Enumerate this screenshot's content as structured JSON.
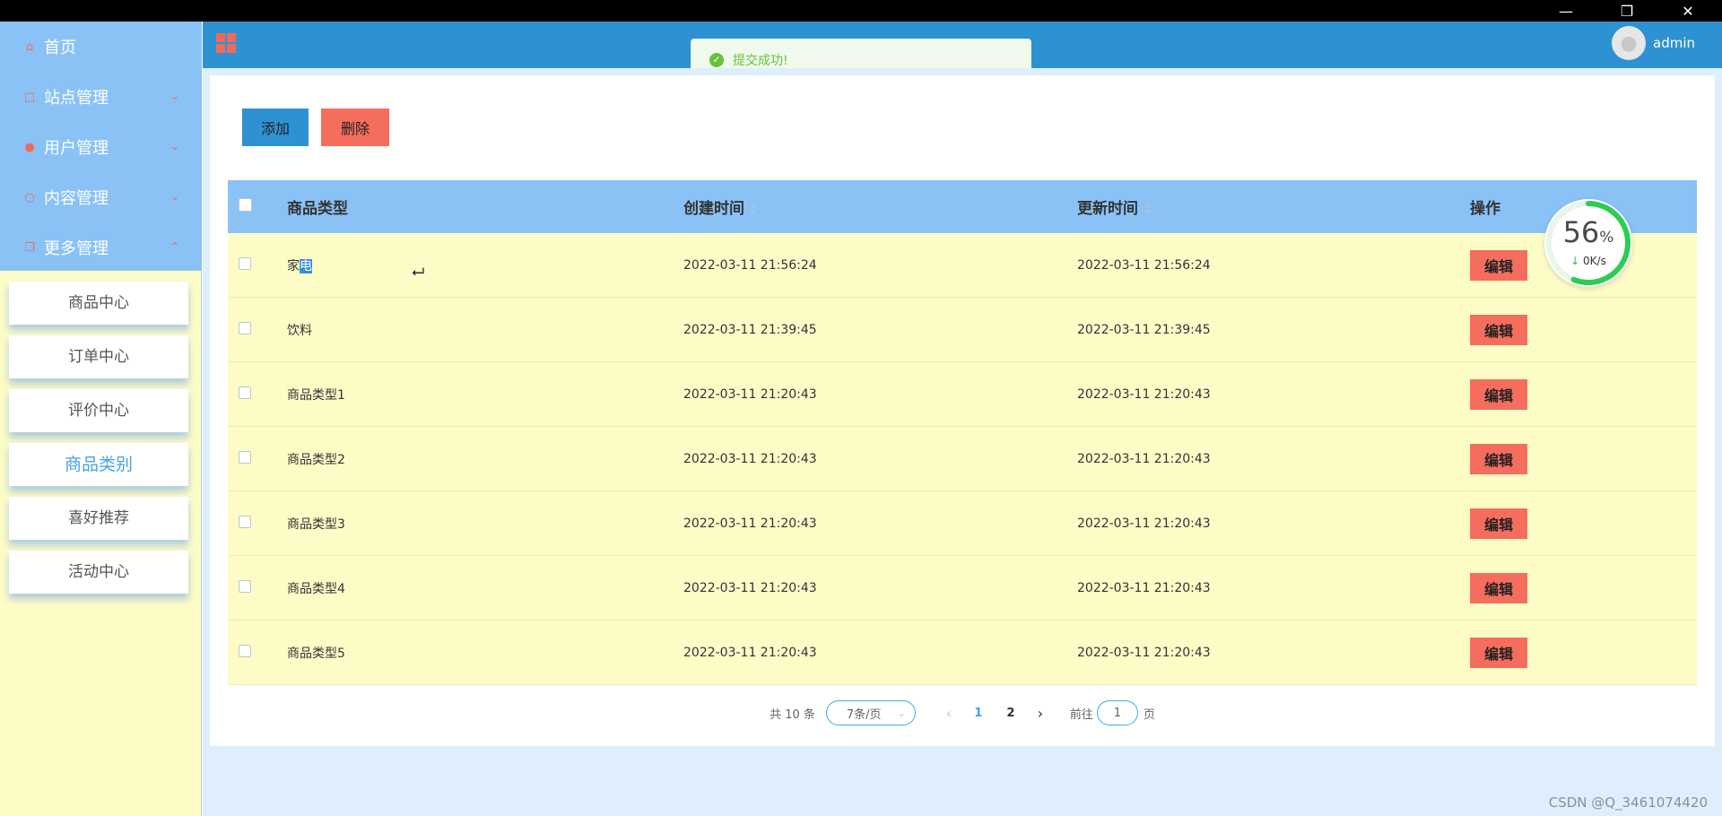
{
  "window": {
    "minimize_icon": "minimize-icon",
    "restore_icon": "restore-icon",
    "close_icon": "close-icon"
  },
  "sidebar": {
    "menu": [
      {
        "label": "首页",
        "icon": "home-icon"
      },
      {
        "label": "站点管理",
        "icon": "monitor-icon"
      },
      {
        "label": "用户管理",
        "icon": "user-icon"
      },
      {
        "label": "内容管理",
        "icon": "content-icon"
      },
      {
        "label": "更多管理",
        "icon": "more-icon"
      }
    ],
    "submenu": [
      "商品中心",
      "订单中心",
      "评价中心",
      "商品类别",
      "喜好推荐",
      "活动中心"
    ],
    "active_submenu": "商品类别"
  },
  "header": {
    "user": "admin"
  },
  "toast": {
    "message": "提交成功!"
  },
  "toolbar": {
    "add_label": "添加",
    "delete_label": "删除"
  },
  "table": {
    "headers": {
      "name": "商品类型",
      "created": "创建时间",
      "updated": "更新时间",
      "op": "操作"
    },
    "edit_label": "编辑",
    "rows": [
      {
        "name_a": "家",
        "name_b": "电",
        "created": "2022-03-11 21:56:24",
        "updated": "2022-03-11 21:56:24"
      },
      {
        "name_a": "饮料",
        "name_b": "",
        "created": "2022-03-11 21:39:45",
        "updated": "2022-03-11 21:39:45"
      },
      {
        "name_a": "商品类型1",
        "name_b": "",
        "created": "2022-03-11 21:20:43",
        "updated": "2022-03-11 21:20:43"
      },
      {
        "name_a": "商品类型2",
        "name_b": "",
        "created": "2022-03-11 21:20:43",
        "updated": "2022-03-11 21:20:43"
      },
      {
        "name_a": "商品类型3",
        "name_b": "",
        "created": "2022-03-11 21:20:43",
        "updated": "2022-03-11 21:20:43"
      },
      {
        "name_a": "商品类型4",
        "name_b": "",
        "created": "2022-03-11 21:20:43",
        "updated": "2022-03-11 21:20:43"
      },
      {
        "name_a": "商品类型5",
        "name_b": "",
        "created": "2022-03-11 21:20:43",
        "updated": "2022-03-11 21:20:43"
      }
    ]
  },
  "pagination": {
    "total": "共 10 条",
    "page_size": "7条/页",
    "pages": [
      "1",
      "2"
    ],
    "current": "1",
    "goto_prefix": "前往",
    "goto_value": "1",
    "goto_suffix": "页"
  },
  "speed_widget": {
    "percent": "56",
    "percent_sign": "%",
    "rate": "0K/s",
    "fraction": 0.56
  },
  "watermark": "CSDN @Q_3461074420",
  "colors": {
    "header": "#2e92d2",
    "sidebar_menu": "#8ac2f6",
    "sidebar_bg": "#fdfcc7",
    "row_bg": "#fdfcc7",
    "accent_red": "#f56e5d",
    "toast_green": "#67c23a"
  }
}
